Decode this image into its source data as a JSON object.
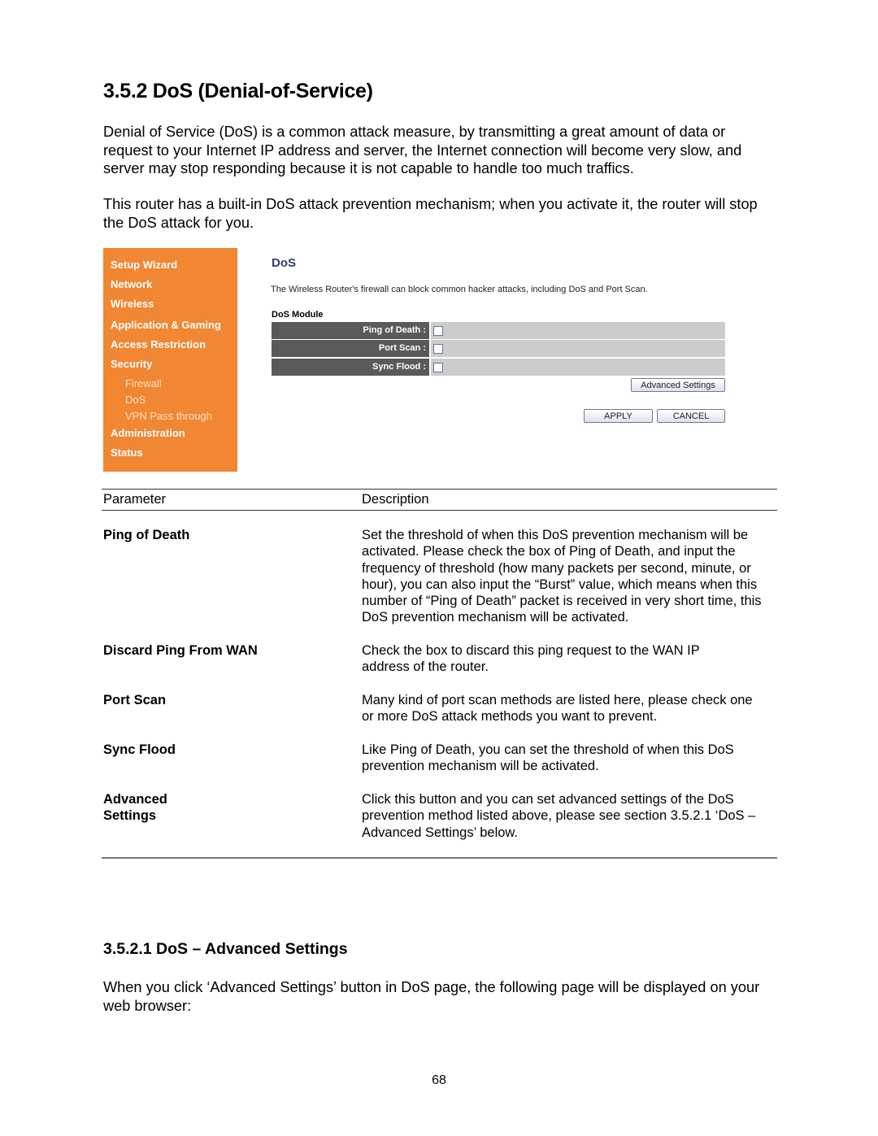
{
  "section": {
    "title": "3.5.2 DoS (Denial-of-Service)",
    "para1": "Denial of Service (DoS) is a common attack measure, by transmitting a great amount of data or request to your Internet IP address and server, the Internet connection will become very slow, and server may stop responding because it is not capable to handle too much traffics.",
    "para2": "This router has a built-in DoS attack prevention mechanism; when you activate it, the router will stop the DoS attack for you."
  },
  "screenshot": {
    "sidebar": {
      "items": [
        "Setup Wizard",
        "Network",
        "Wireless",
        "Application & Gaming",
        "Access Restriction",
        "Security"
      ],
      "sub_items": [
        "Firewall",
        "DoS",
        "VPN Pass through"
      ],
      "items_after": [
        "Administration",
        "Status"
      ]
    },
    "page_title": "DoS",
    "description": "The Wireless Router's firewall can block common hacker attacks, including DoS and Port Scan.",
    "module_title": "DoS Module",
    "rows": [
      {
        "label": "Ping of Death :",
        "checked": false
      },
      {
        "label": "Port Scan :",
        "checked": false
      },
      {
        "label": "Sync Flood :",
        "checked": false
      }
    ],
    "advanced_button": "Advanced Settings",
    "apply_button": "APPLY",
    "cancel_button": "CANCEL",
    "colors": {
      "sidebar": "#f18633",
      "label_bg": "#5a5a5a",
      "value_bg": "#cccccc",
      "title": "#2f3f6f"
    }
  },
  "table": {
    "headers": [
      "Parameter",
      "Description"
    ],
    "rows": [
      {
        "param": "Ping of Death",
        "desc": "Set the threshold of when this DoS prevention mechanism will be activated. Please check the box of Ping of Death, and input the frequency of threshold (how many packets per second, minute, or hour), you can also input the “Burst” value, which means when this number of “Ping of Death” packet is received in very short time, this DoS prevention mechanism will be activated."
      },
      {
        "param": "Discard Ping From WAN",
        "desc": "Check the box to discard this ping request to the WAN IP address of the router."
      },
      {
        "param": "Port Scan",
        "desc": "Many kind of port scan methods are listed here, please check one or more DoS attack methods you want to prevent."
      },
      {
        "param": "Sync Flood",
        "desc": "Like Ping of Death, you can set the threshold of when this DoS prevention mechanism will be activated."
      },
      {
        "param": "Advanced Settings",
        "desc": "Click this button and you can set advanced settings of the DoS prevention method listed above, please see section 3.5.2.1 ‘DoS – Advanced Settings’ below."
      }
    ]
  },
  "subsection": {
    "title": "3.5.2.1 DoS – Advanced Settings",
    "para": "When you click ‘Advanced Settings’ button in DoS page, the following page will be displayed on your web browser:"
  },
  "page_number": "68"
}
